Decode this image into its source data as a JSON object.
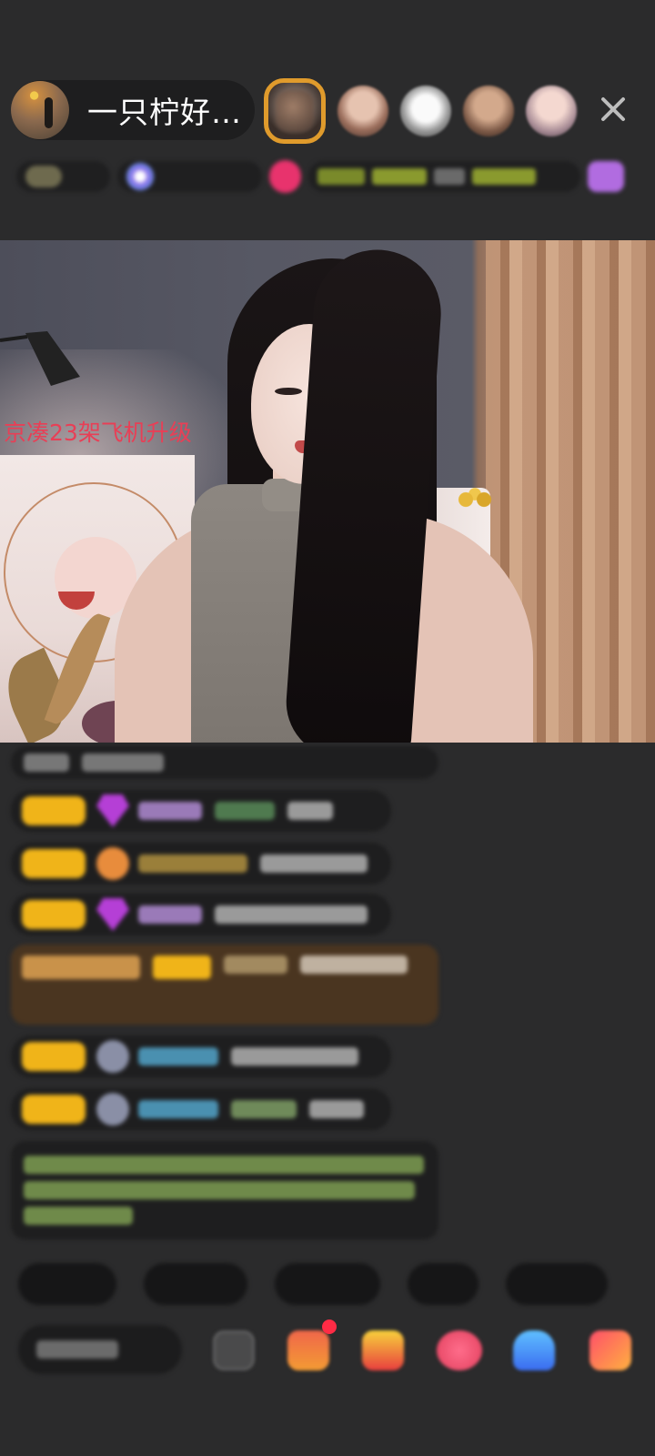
{
  "header": {
    "host_name": "一只柠好…",
    "close_icon": "close-icon",
    "viewer_avatars": [
      "top-viewer-1",
      "viewer-2",
      "viewer-3",
      "viewer-4",
      "viewer-5"
    ]
  },
  "video": {
    "overlay_text": "京凑23架飞机升级"
  },
  "colors": {
    "background": "#2b2b2c",
    "level_badge": "#f0b419",
    "overlay_text": "#e83f56",
    "top_viewer_ring": "#e09b2c"
  },
  "icons": [
    "close-icon",
    "gift-box-icon",
    "red-envelope-icon",
    "heart-icon",
    "game-icon",
    "more-icon"
  ]
}
